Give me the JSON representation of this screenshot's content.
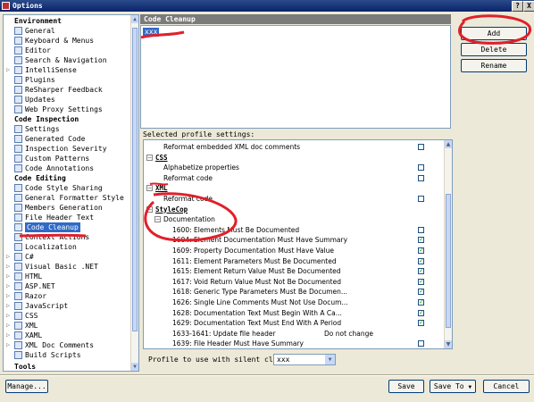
{
  "window": {
    "title": "Options",
    "help_label": "?",
    "close_label": "X"
  },
  "tree": {
    "environment": {
      "header": "Environment",
      "items": [
        "General",
        "Keyboard & Menus",
        "Editor",
        "Search & Navigation",
        "IntelliSense",
        "Plugins",
        "ReSharper Feedback",
        "Updates",
        "Web Proxy Settings"
      ]
    },
    "code_inspection": {
      "header": "Code Inspection",
      "items": [
        "Settings",
        "Generated Code",
        "Inspection Severity",
        "Custom Patterns",
        "Code Annotations"
      ]
    },
    "code_editing": {
      "header": "Code Editing",
      "items": [
        "Code Style Sharing",
        "General Formatter Style",
        "Members Generation",
        "File Header Text",
        "Code Cleanup",
        "Context Actions",
        "Localization",
        "C#",
        "Visual Basic .NET",
        "HTML",
        "ASP.NET",
        "Razor",
        "JavaScript",
        "CSS",
        "XML",
        "XAML",
        "XML Doc Comments",
        "Build Scripts"
      ]
    },
    "tools": {
      "header": "Tools"
    }
  },
  "panel": {
    "header": "Code Cleanup",
    "profiles": [
      "xxx"
    ],
    "buttons": {
      "add": "Add",
      "delete": "Delete",
      "rename": "Rename"
    },
    "selected_profile_label": "Selected profile settings:",
    "settings_rows": [
      {
        "kind": "item",
        "text": "Reformat embedded XML doc comments",
        "checked": false
      },
      {
        "kind": "group",
        "text": "CSS"
      },
      {
        "kind": "item",
        "text": "Alphabetize properties",
        "checked": false
      },
      {
        "kind": "item",
        "text": "Reformat code",
        "checked": false
      },
      {
        "kind": "group",
        "text": "XML"
      },
      {
        "kind": "item",
        "text": "Reformat code",
        "checked": false
      },
      {
        "kind": "group",
        "text": "StyleCop"
      },
      {
        "kind": "sub",
        "text": "Documentation"
      },
      {
        "kind": "item2",
        "text": "1600: Elements Must Be Documented",
        "checked": false
      },
      {
        "kind": "item2",
        "text": "1604: Element Documentation Must Have Summary",
        "checked": true
      },
      {
        "kind": "item2",
        "text": "1609: Property Documentation Must Have Value",
        "checked": true
      },
      {
        "kind": "item2",
        "text": "1611: Element Parameters Must Be Documented",
        "checked": true
      },
      {
        "kind": "item2",
        "text": "1615: Element Return Value Must Be Documented",
        "checked": true
      },
      {
        "kind": "item2",
        "text": "1617: Void Return Value Must Not Be Documented",
        "checked": true
      },
      {
        "kind": "item2",
        "text": "1618: Generic Type Parameters Must Be Documen...",
        "checked": true
      },
      {
        "kind": "item2",
        "text": "1626: Single Line Comments Must Not Use Docum...",
        "checked": true
      },
      {
        "kind": "item2",
        "text": "1628: Documentation Text Must Begin With A Ca...",
        "checked": true
      },
      {
        "kind": "item2",
        "text": "1629: Documentation Text Must End With A Period",
        "checked": true
      },
      {
        "kind": "item2",
        "text": "1633-1641: Update file header",
        "value": "Do not change"
      },
      {
        "kind": "item2",
        "text": "1639: File Header Must Have Summary",
        "checked": false
      }
    ],
    "silent_label": "Profile to use with silent clean-up:",
    "silent_value": "xxx"
  },
  "footer": {
    "manage": "Manage...",
    "save": "Save",
    "save_to": "Save To",
    "cancel": "Cancel"
  },
  "colors": {
    "selection": "#316ac5",
    "annotation": "#e0202a",
    "check": "#21a121"
  }
}
